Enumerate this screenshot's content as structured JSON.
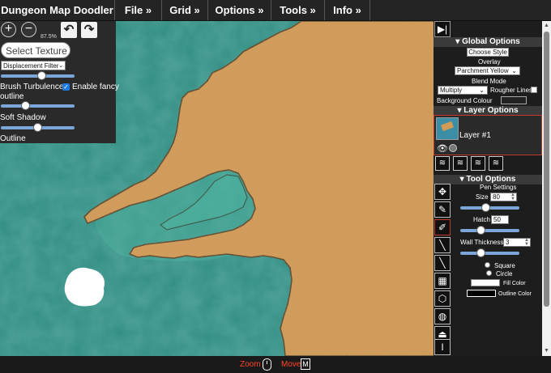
{
  "menu": {
    "title": "Dungeon Map Doodler",
    "items": [
      "File »",
      "Grid »",
      "Options »",
      "Tools »",
      "Info »"
    ]
  },
  "left_panel": {
    "zoom_percent": "87.5%",
    "select_texture": "Select Texture",
    "filter_value": "Displacement Filter",
    "brush_turbulence_label": "Brush Turbulence",
    "fancy_outline_label_line1": "Enable fancy",
    "fancy_outline_label_line2": "outline",
    "fancy_outline_checked": true,
    "soft_shadow_label": "Soft Shadow",
    "outline_label": "Outline",
    "displacement_level": 0.5,
    "turbulence_level": 0.3,
    "soft_shadow_level": 0.48
  },
  "global_options": {
    "header": "▾ Global Options",
    "choose_style": "Choose Style",
    "overlay_label": "Overlay",
    "overlay_value": "Parchment Yellow",
    "blend_mode_label": "Blend Mode",
    "blend_mode_value": "Multiply",
    "rougher_lines_label": "Rougher Lines",
    "background_colour_label": "Background Colour"
  },
  "layer_options": {
    "header": "▾ Layer Options",
    "layer_name": "Layer #1"
  },
  "tool_options": {
    "header": "▾ Tool Options",
    "pen_settings_label": "Pen Settings",
    "size_label": "Size",
    "size_value": "80",
    "hatch_label": "Hatch",
    "hatch_value": "50",
    "wall_thickness_label": "Wall Thickness",
    "wall_thickness_value": "3",
    "square_label": "Square",
    "circle_label": "Circle",
    "fill_color_label": "Fill Color",
    "outline_color_label": "Outline Color",
    "size_level": 0.45,
    "hatch_level": 0.3,
    "wall_level": 0.18
  },
  "colors": {
    "water": "#2f8c82",
    "land": "#d39a55",
    "coast": "#3c2a15",
    "accent_red": "#ff4422"
  },
  "status": {
    "zoom_label": "Zoom",
    "move_label": "Move",
    "move_key": "M"
  }
}
